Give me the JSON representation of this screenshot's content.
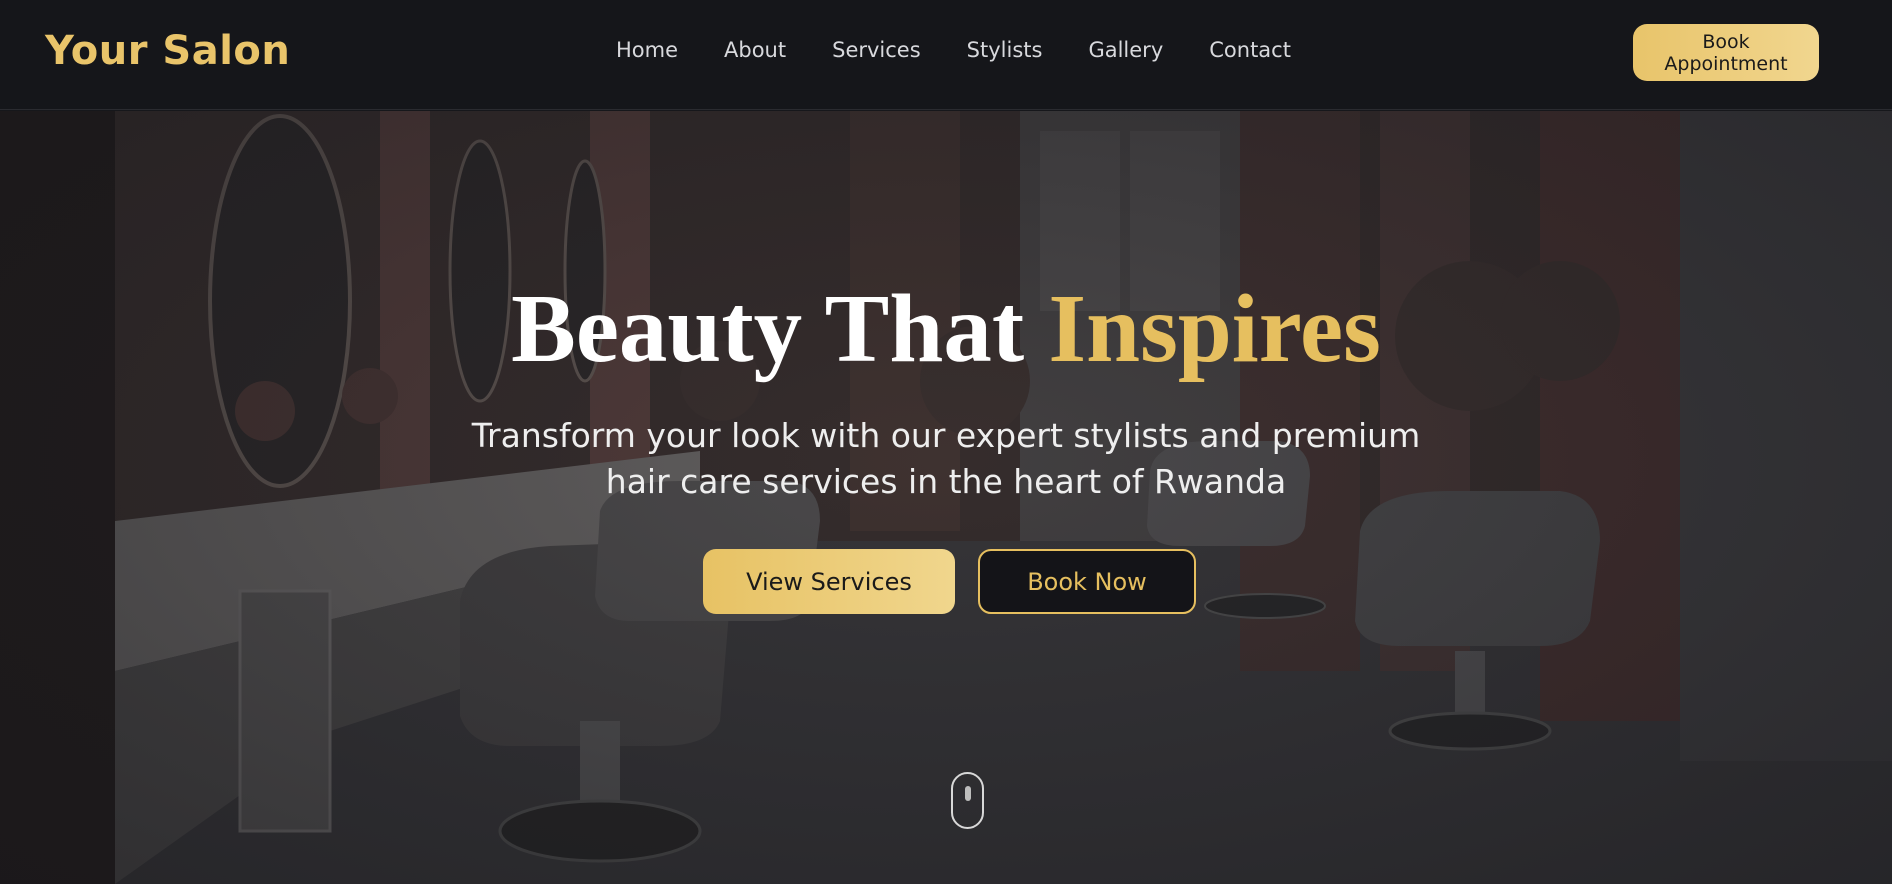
{
  "header": {
    "logo": "Your Salon",
    "nav": [
      "Home",
      "About",
      "Services",
      "Stylists",
      "Gallery",
      "Contact"
    ],
    "cta": "Book Appointment"
  },
  "hero": {
    "title_main": "Beauty That",
    "title_accent": "Inspires",
    "subtitle": "Transform your look with our expert stylists and premium hair care services in the heart of Rwanda",
    "primary_button": "View Services",
    "secondary_button": "Book Now",
    "background_image": "salon interior with mirrors, vanity, styling chairs and curtains"
  },
  "colors": {
    "accent": "#e6bf5f",
    "header_bg": "#15161a"
  }
}
